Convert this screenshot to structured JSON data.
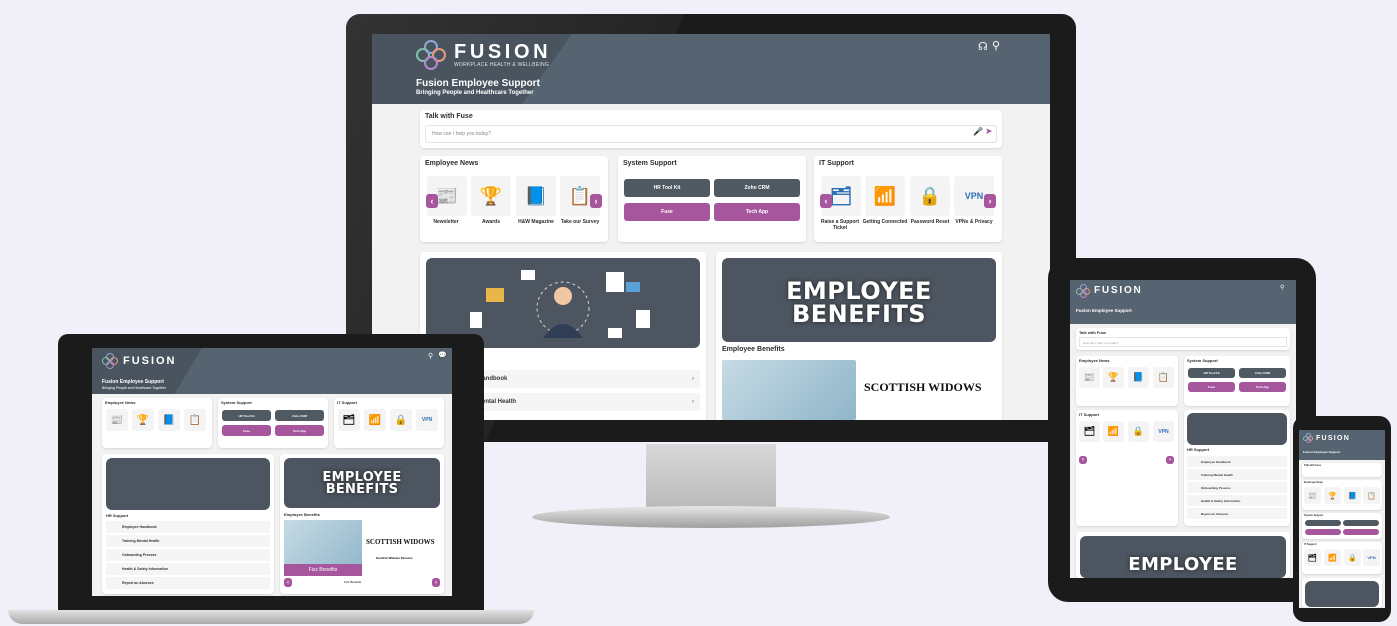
{
  "app": {
    "brand": "FUSION",
    "brand_sub": "WORKPLACE HEALTH & WELLBEING",
    "title": "Fusion Employee Support",
    "subtitle": "Bringing People and Healthcare Together"
  },
  "chat": {
    "title": "Talk with Fuse",
    "placeholder": "How can I help you today?"
  },
  "employee_news": {
    "title": "Employee News",
    "items": [
      "Newsletter",
      "Awards",
      "H&W Magazine",
      "Take our Survey"
    ]
  },
  "system_support": {
    "title": "System Support",
    "buttons": [
      "HR Tool Kit",
      "Zoho CRM",
      "Fuse",
      "Tech App"
    ]
  },
  "it_support": {
    "title": "IT Support",
    "items": [
      "Raise a Support Ticket",
      "Getting Connected",
      "Password Reset",
      "VPNs & Privacy"
    ]
  },
  "hr_support": {
    "title": "HR Support",
    "items": [
      "Employee Handbook",
      "Training Mental Health",
      "Onboarding Process",
      "Health & Safety Information",
      "Report an Absence"
    ],
    "partial_items": [
      "Handbook",
      "ental Health"
    ]
  },
  "benefits": {
    "banner": "EMPLOYEE BENEFITS",
    "banner_line1": "EMPLOYEE",
    "banner_line2": "BENEFITS",
    "title": "Employee Benefits",
    "partner": "SCOTTISH WIDOWS",
    "partner_caption": "Scottish Widows Pension",
    "fizz": "Fizz Benefits",
    "tile_vpn": "VPN"
  },
  "colors": {
    "accent": "#a6569c",
    "header": "#566370",
    "dark_button": "#4e5962"
  }
}
